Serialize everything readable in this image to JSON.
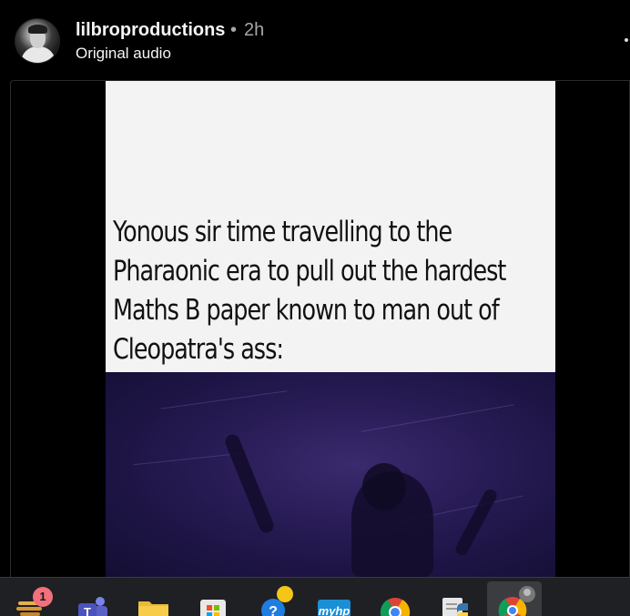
{
  "post": {
    "username": "lilbroproductions",
    "separator": "•",
    "time": "2h",
    "audio": "Original audio"
  },
  "video": {
    "caption_lines": [
      "Yonous sir time travelling to the",
      "Pharaonic era to pull out the hardest",
      "Maths B paper known to man out of",
      "Cleopatra's ass:"
    ]
  },
  "taskbar": {
    "notification_count": "1",
    "apps": [
      {
        "name": "widgets-icon"
      },
      {
        "name": "teams-icon"
      },
      {
        "name": "file-explorer-icon"
      },
      {
        "name": "microsoft-store-icon"
      },
      {
        "name": "help-icon"
      },
      {
        "name": "myhp-icon",
        "label": "myhp"
      },
      {
        "name": "chrome-icon"
      },
      {
        "name": "python-icon"
      },
      {
        "name": "chrome-profile-icon"
      }
    ]
  },
  "colors": {
    "background": "#000000",
    "muted_text": "#a8a8a8",
    "caption_bg": "#f3f3f3",
    "scene_purple": "#2a1d58",
    "taskbar_bg": "#1f2023",
    "badge": "#f1707b"
  }
}
